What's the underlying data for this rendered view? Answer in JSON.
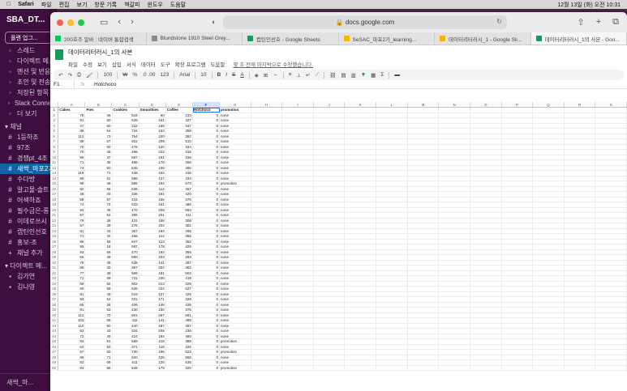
{
  "menubar": {
    "app": "Safari",
    "items": [
      "파일",
      "편집",
      "보기",
      "방문 기록",
      "책갈피",
      "윈도우",
      "도움말"
    ],
    "datetime": "12월 13일 (화) 오전 10:31"
  },
  "slack": {
    "workspace": "SBA_DT...",
    "upgrade": "플랜 업그...",
    "nav": [
      "스레드",
      "다이렉트 메...",
      "멘션 및 반응",
      "초안 및 전송...",
      "저장된 항목",
      "Slack Conne...",
      "더 보기"
    ],
    "channels_header": "채널",
    "channels": [
      "1등하조",
      "97조",
      "경쟁pt_4조",
      "새싹_마포2기",
      "수다방",
      "알고물-솔트",
      "어색하죠",
      "필수금은-롱",
      "이데로쓰시",
      "캡틴인선호",
      "홍보-조",
      "채널 추가"
    ],
    "selected_channel_index": 3,
    "dm_header": "다이렉트 메...",
    "dms": [
      "김가연",
      "김나영"
    ],
    "bottom": "새싹_마..."
  },
  "browser": {
    "url": "docs.google.com",
    "tabs": [
      {
        "label": "200호주 알바 : 네이버 통합검색",
        "color": "#03c75a"
      },
      {
        "label": "Blundstone 1910 Steel Grey...",
        "color": "#8a8a8a"
      },
      {
        "label": "캡틴인선호 - Google Sheets",
        "color": "#0f9d58"
      },
      {
        "label": "SeSAC_마포2기_learning...",
        "color": "#f4b400"
      },
      {
        "label": "데이터리터러시_1 - Google Sli...",
        "color": "#f4b400"
      },
      {
        "label": "데이터리터러시_1의 사본 - Goo...",
        "color": "#0f9d58"
      }
    ],
    "active_tab_index": 5
  },
  "sheet": {
    "title": "데이터리터러시_1의 사본",
    "menus": [
      "파일",
      "수정",
      "보기",
      "삽입",
      "서식",
      "데이터",
      "도구",
      "확장 프로그램",
      "도움말"
    ],
    "last_edit": "몇 초 전에 마지막으로 수정했습니다.",
    "toolbar": {
      "zoom": "100",
      "currency": "₩",
      "percent": "%",
      "decimals": ".0 .00",
      "format": "123",
      "font": "Arial",
      "size": "10"
    },
    "name_box": "F1",
    "formula_value": "Hotchoco",
    "columns": [
      "A",
      "B",
      "C",
      "D",
      "E",
      "F",
      "G",
      "H",
      "I",
      "J",
      "K",
      "L",
      "M",
      "N",
      "O",
      "P",
      "Q",
      "R",
      "S"
    ],
    "selected_column": "F",
    "headers": [
      "Cakes",
      "Pies",
      "Cookies",
      "Smoothies",
      "Coffee",
      "Hotchoco",
      "promotion"
    ],
    "rows": [
      [
        79,
        46,
        518,
        60,
        233,
        0,
        "none"
      ],
      [
        91,
        50,
        539,
        161,
        427,
        0,
        "none"
      ],
      [
        47,
        60,
        222,
        168,
        347,
        0,
        "none"
      ],
      [
        89,
        64,
        734,
        153,
        358,
        0,
        "none"
      ],
      [
        112,
        73,
        764,
        240,
        392,
        0,
        "none"
      ],
      [
        89,
        57,
        922,
        209,
        510,
        0,
        "none"
      ],
      [
        70,
        50,
        476,
        120,
        334,
        0,
        "none"
      ],
      [
        70,
        48,
        496,
        222,
        316,
        0,
        "none"
      ],
      [
        99,
        37,
        587,
        191,
        156,
        0,
        "none"
      ],
      [
        71,
        38,
        488,
        178,
        266,
        0,
        "none"
      ],
      [
        74,
        50,
        645,
        100,
        490,
        0,
        "none"
      ],
      [
        119,
        71,
        438,
        162,
        416,
        0,
        "none"
      ],
      [
        90,
        51,
        588,
        137,
        434,
        0,
        "none"
      ],
      [
        96,
        48,
        585,
        194,
        573,
        0,
        "promotion"
      ],
      [
        82,
        66,
        536,
        112,
        267,
        0,
        "none"
      ],
      [
        48,
        33,
        336,
        151,
        420,
        0,
        "none"
      ],
      [
        58,
        67,
        434,
        166,
        376,
        0,
        "none"
      ],
      [
        74,
        74,
        533,
        161,
        486,
        0,
        "none"
      ],
      [
        94,
        45,
        470,
        208,
        584,
        0,
        "none"
      ],
      [
        97,
        54,
        395,
        201,
        411,
        0,
        "none"
      ],
      [
        79,
        38,
        431,
        158,
        308,
        0,
        "none"
      ],
      [
        67,
        39,
        276,
        204,
        382,
        0,
        "none"
      ],
      [
        81,
        43,
        387,
        184,
        295,
        0,
        "none"
      ],
      [
        71,
        42,
        456,
        114,
        365,
        0,
        "none"
      ],
      [
        96,
        58,
        647,
        113,
        362,
        0,
        "none"
      ],
      [
        95,
        18,
        597,
        178,
        425,
        0,
        "none"
      ],
      [
        93,
        66,
        470,
        192,
        355,
        0,
        "none"
      ],
      [
        60,
        49,
        590,
        203,
        293,
        0,
        "none"
      ],
      [
        79,
        38,
        535,
        141,
        287,
        0,
        "none"
      ],
      [
        80,
        40,
        397,
        204,
        382,
        0,
        "none"
      ],
      [
        77,
        49,
        568,
        181,
        503,
        0,
        "none"
      ],
      [
        71,
        59,
        731,
        236,
        419,
        0,
        "none"
      ],
      [
        89,
        62,
        602,
        213,
        329,
        0,
        "none"
      ],
      [
        90,
        59,
        536,
        224,
        627,
        0,
        "none"
      ],
      [
        81,
        49,
        518,
        127,
        429,
        0,
        "none"
      ],
      [
        93,
        54,
        331,
        171,
        328,
        0,
        "none"
      ],
      [
        65,
        34,
        406,
        148,
        435,
        0,
        "none"
      ],
      [
        81,
        53,
        430,
        150,
        376,
        0,
        "none"
      ],
      [
        112,
        70,
        601,
        267,
        581,
        0,
        "none"
      ],
      [
        103,
        58,
        411,
        141,
        488,
        0,
        "none"
      ],
      [
        110,
        60,
        440,
        187,
        387,
        0,
        "none"
      ],
      [
        63,
        43,
        334,
        208,
        236,
        0,
        "none"
      ],
      [
        72,
        49,
        424,
        184,
        480,
        0,
        "none"
      ],
      [
        93,
        61,
        589,
        218,
        388,
        0,
        "promotion"
      ],
      [
        63,
        53,
        371,
        118,
        226,
        0,
        "none"
      ],
      [
        67,
        50,
        730,
        195,
        523,
        0,
        "promotion"
      ],
      [
        86,
        71,
        620,
        226,
        568,
        0,
        "none"
      ],
      [
        83,
        69,
        611,
        125,
        535,
        0,
        "none"
      ],
      [
        84,
        56,
        549,
        179,
        320,
        0,
        "promotion"
      ]
    ]
  },
  "colors": {
    "accent": "#1a73e8",
    "sheets_green": "#0f9d58",
    "slack_bg": "#3f0e40",
    "slack_selected": "#1164a3"
  }
}
